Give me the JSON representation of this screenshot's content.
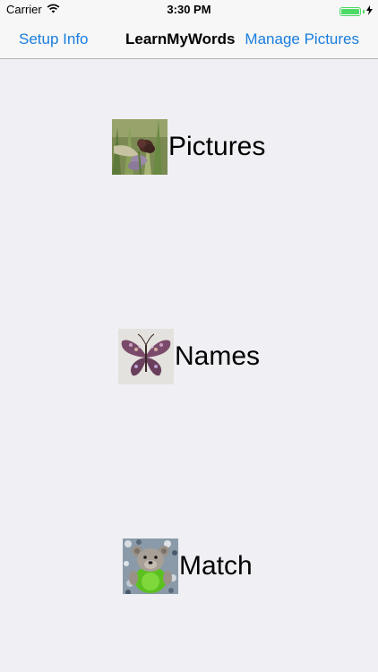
{
  "status_bar": {
    "carrier": "Carrier",
    "time": "3:30 PM"
  },
  "nav": {
    "left_button": "Setup Info",
    "title": "LearnMyWords",
    "right_button": "Manage Pictures"
  },
  "menu": {
    "items": [
      {
        "label": "Pictures",
        "icon": "flower-photo"
      },
      {
        "label": "Names",
        "icon": "butterfly-photo"
      },
      {
        "label": "Match",
        "icon": "teddy-bear-photo"
      }
    ]
  },
  "colors": {
    "background": "#efeff4",
    "bar": "#f7f7f7",
    "tint": "#1a7de0",
    "battery": "#4cd964"
  }
}
